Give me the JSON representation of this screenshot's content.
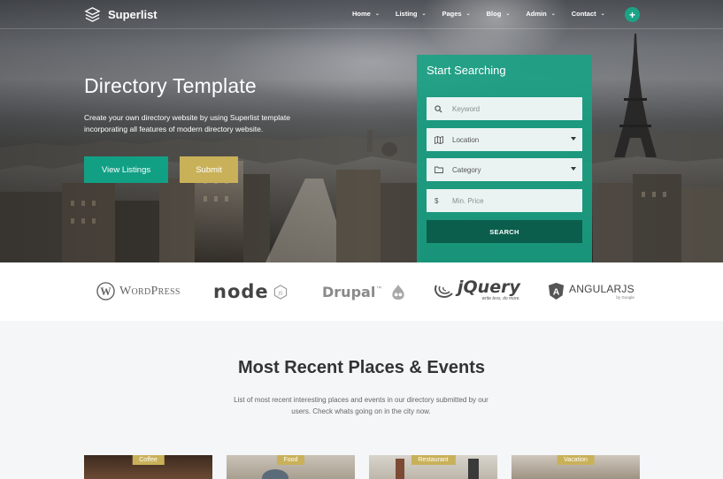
{
  "brand": {
    "name": "Superlist"
  },
  "nav": {
    "items": [
      {
        "label": "Home"
      },
      {
        "label": "Listing"
      },
      {
        "label": "Pages"
      },
      {
        "label": "Blog"
      },
      {
        "label": "Admin"
      },
      {
        "label": "Contact"
      }
    ],
    "add_label": "+"
  },
  "hero": {
    "title": "Directory Template",
    "description": "Create your own directory website by using Superlist template incorporating all features of modern directory website.",
    "primary_button": "View Listings",
    "secondary_button": "Submit"
  },
  "search": {
    "title": "Start Searching",
    "keyword_placeholder": "Keyword",
    "location_value": "Location",
    "category_value": "Category",
    "price_placeholder": "Min. Price",
    "price_symbol": "$",
    "button": "SEARCH"
  },
  "partners": {
    "wordpress": "WordPress",
    "node": "node",
    "drupal": "Drupal",
    "jquery": "jQuery",
    "jquery_tagline": "write less, do more.",
    "angular": "ANGULARJS",
    "angular_tagline": "by Google"
  },
  "recent": {
    "title": "Most Recent Places & Events",
    "description": "List of most recent interesting places and events in our directory submitted by our users. Check whats going on in the city now.",
    "cards": [
      {
        "category": "Coffee"
      },
      {
        "category": "Food"
      },
      {
        "category": "Restaurant"
      },
      {
        "category": "Vacation"
      }
    ]
  },
  "colors": {
    "accent": "#12a085",
    "gold": "#c9b15a",
    "dark_teal": "#0b5e4c"
  }
}
